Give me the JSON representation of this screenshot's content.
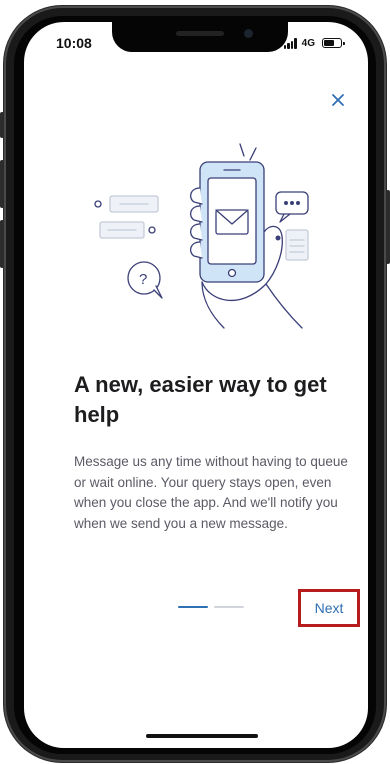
{
  "status_bar": {
    "time": "10:08",
    "network": "4G"
  },
  "onboarding": {
    "close_icon": "close-icon",
    "illustration_icon": "phone-message-icon",
    "title": "A new, easier way to get help",
    "body": "Message us any time without having to queue or wait online. Your query stays open, even when you close the app. And we'll notify you when we send you a new message.",
    "pager": {
      "current": 1,
      "total": 2
    },
    "next_label": "Next"
  },
  "colors": {
    "accent": "#2f6fb3",
    "highlight_border": "#b71c1c",
    "illustration_fill": "#cfe4f7",
    "illustration_stroke": "#3a3f78",
    "title": "#1d1d1f",
    "body": "#5b5b66"
  }
}
